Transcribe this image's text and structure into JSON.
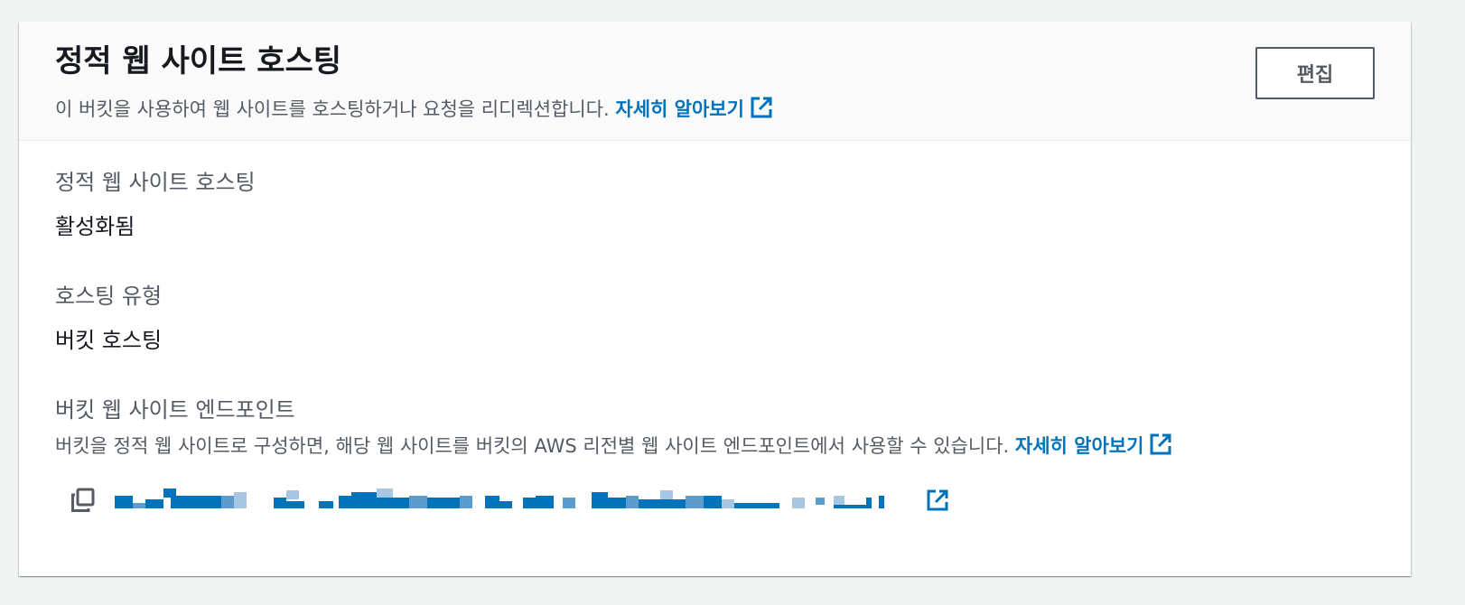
{
  "header": {
    "title": "정적 웹 사이트 호스팅",
    "description": "이 버킷을 사용하여 웹 사이트를 호스팅하거나 요청을 리디렉션합니다.",
    "learn_more": "자세히 알아보기",
    "edit_label": "편집"
  },
  "fields": {
    "hosting": {
      "label": "정적 웹 사이트 호스팅",
      "value": "활성화됨"
    },
    "hosting_type": {
      "label": "호스팅 유형",
      "value": "버킷 호스팅"
    },
    "endpoint": {
      "label": "버킷 웹 사이트 엔드포인트",
      "description": "버킷을 정적 웹 사이트로 구성하면, 해당 웹 사이트를 버킷의 AWS 리전별 웹 사이트 엔드포인트에서 사용할 수 있습니다.",
      "learn_more": "자세히 알아보기",
      "url": ""
    }
  },
  "icons": {
    "copy": "copy-icon",
    "external_link": "external-link-icon"
  },
  "colors": {
    "link": "#0073bb",
    "text": "#16191f",
    "secondary_text": "#545b64",
    "header_bg": "#fafafa",
    "page_bg": "#f2f3f3"
  }
}
